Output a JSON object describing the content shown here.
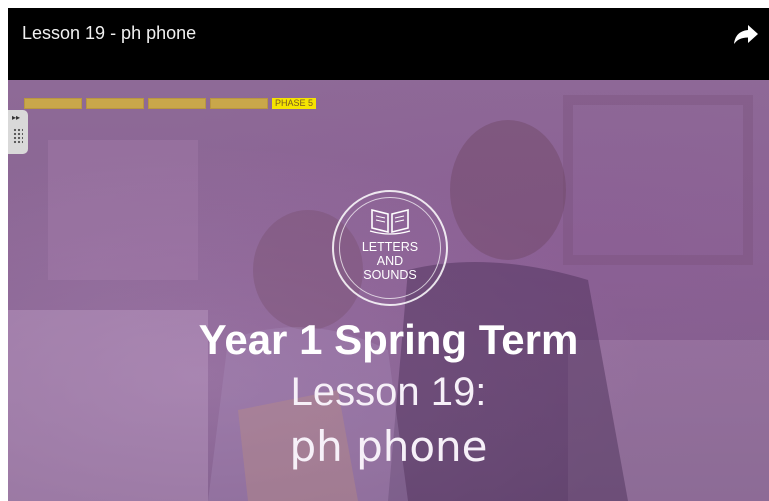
{
  "video": {
    "title": "Lesson 19 - ph phone",
    "share_icon": "share-arrow-icon",
    "progress": {
      "segments": 4,
      "phase_label": "PHASE 5",
      "colors": {
        "segment": "#c9a74a",
        "phase_bg": "#f5e400"
      }
    },
    "logo": {
      "line1": "LETTERS",
      "line2": "AND",
      "line3": "SOUNDS",
      "icon": "open-book-icon"
    },
    "headline": "Year 1 Spring Term",
    "lesson": "Lesson 19:",
    "topic": "ph phone",
    "overlay_color": "#8a6593"
  }
}
